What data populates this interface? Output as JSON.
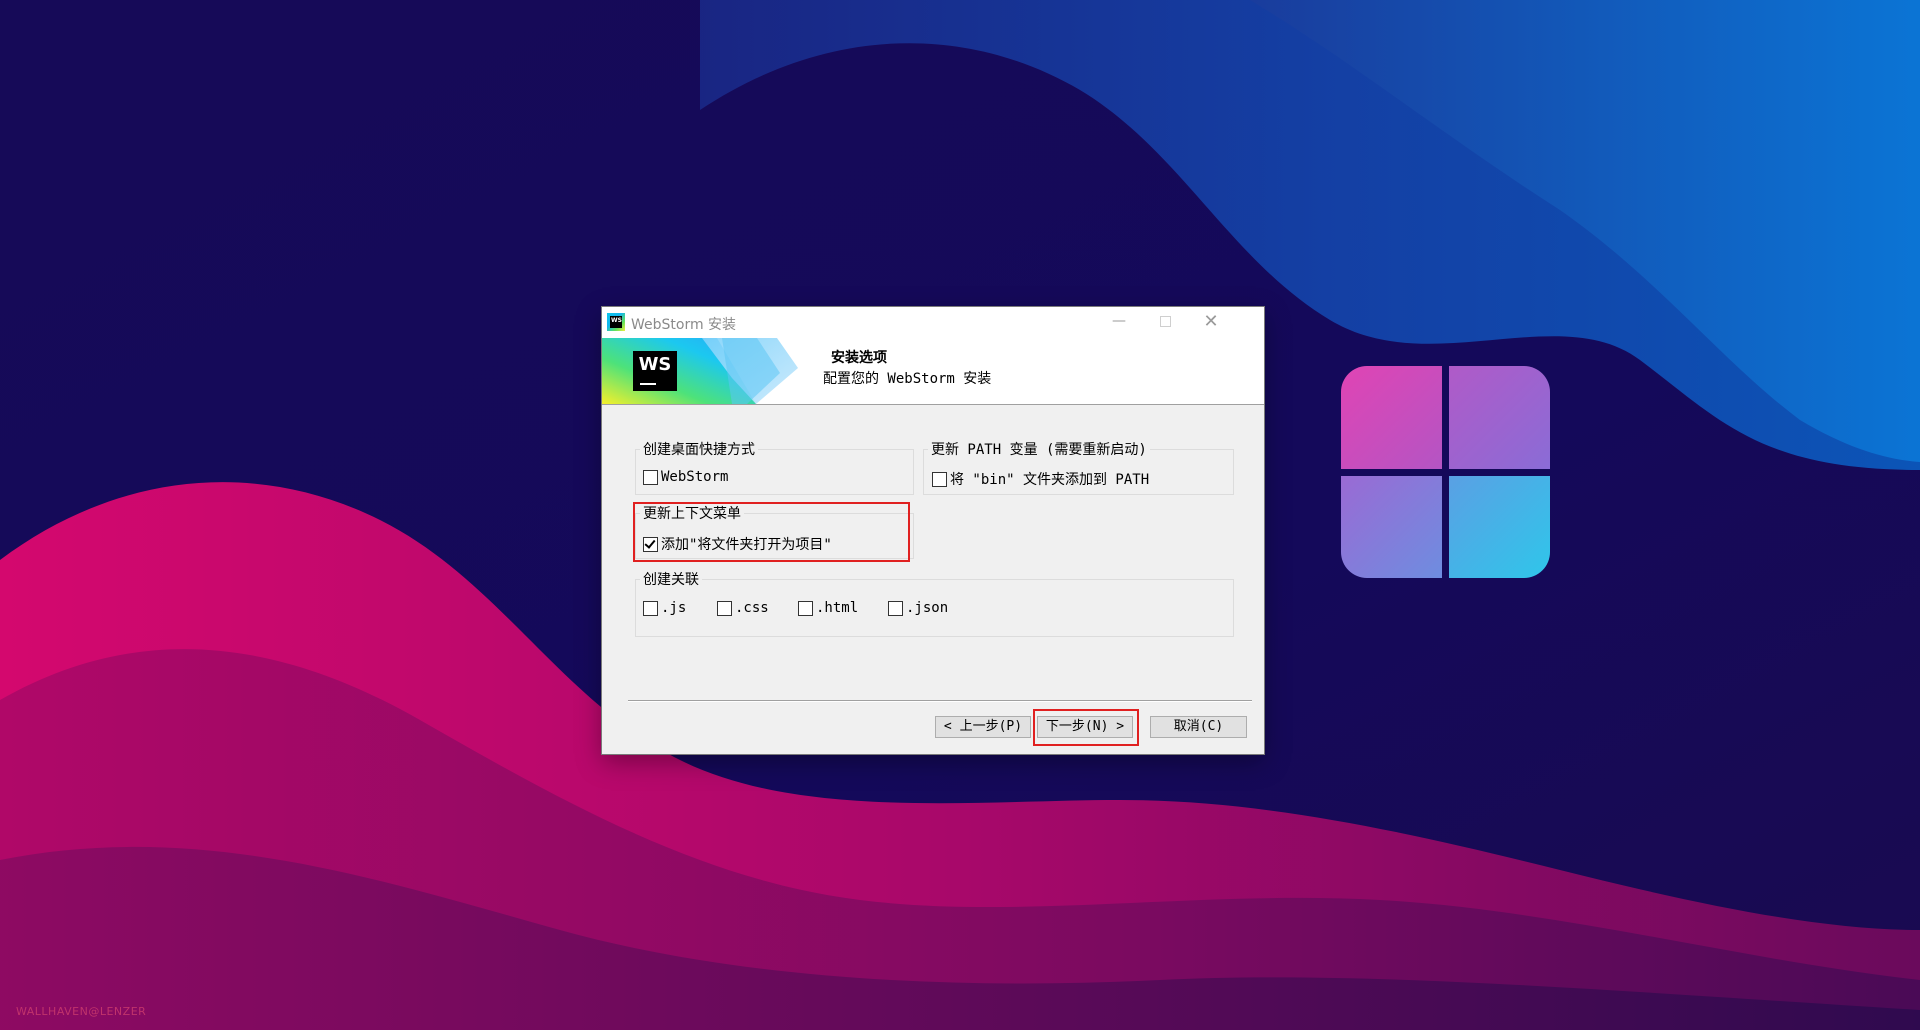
{
  "desktop": {
    "watermark": "WALLHAVEN@LENZER"
  },
  "window": {
    "title": "WebStorm 安装",
    "min_glyph": "—",
    "close_glyph": "✕",
    "app_icon_text": "WS"
  },
  "banner": {
    "logo_text": "WS",
    "heading": "安装选项",
    "subheading": "配置您的 WebStorm 安装"
  },
  "groups": {
    "desktop_shortcut": {
      "label": "创建桌面快捷方式",
      "option": {
        "label": "WebStorm",
        "checked": false
      }
    },
    "path_update": {
      "label": "更新 PATH 变量 (需要重新启动)",
      "option": {
        "label": "将 \"bin\" 文件夹添加到 PATH",
        "checked": false
      }
    },
    "context_menu": {
      "label": "更新上下文菜单",
      "option": {
        "label": "添加\"将文件夹打开为项目\"",
        "checked": true
      }
    },
    "associations": {
      "label": "创建关联",
      "options": [
        {
          "label": ".js",
          "checked": false
        },
        {
          "label": ".css",
          "checked": false
        },
        {
          "label": ".html",
          "checked": false
        },
        {
          "label": ".json",
          "checked": false
        }
      ]
    }
  },
  "buttons": {
    "back": "< 上一步(P)",
    "next": "下一步(N) >",
    "cancel": "取消(C)"
  },
  "colors": {
    "highlight": "#e02020",
    "window_bg": "#f0f0f0"
  }
}
